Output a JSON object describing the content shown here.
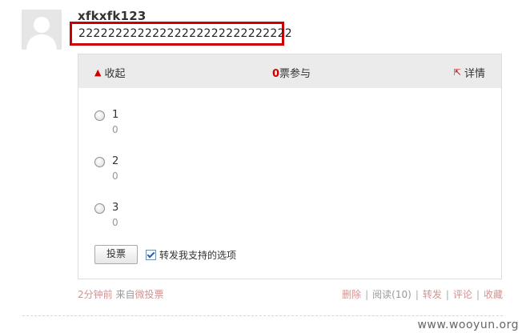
{
  "post": {
    "username": "xfkxfk123",
    "text": "22222222222222222222222222222"
  },
  "poll": {
    "collapse_label": "收起",
    "vote_count": "0",
    "vote_suffix": "票参与",
    "detail_label": "详情",
    "options": [
      {
        "label": "1",
        "count": "0"
      },
      {
        "label": "2",
        "count": "0"
      },
      {
        "label": "3",
        "count": "0"
      }
    ],
    "vote_button": "投票",
    "repost_checked": true,
    "repost_label": "转发我支持的选项"
  },
  "footer": {
    "time": "2分钟前",
    "from_prefix": "来自",
    "source": "微投票",
    "delete": "删除",
    "read": "阅读(10)",
    "forward": "转发",
    "comment": "评论",
    "favorite": "收藏"
  },
  "watermark": "www.wooyun.org",
  "colors": {
    "accent_red": "#cc0000",
    "link_pink": "#d29393"
  }
}
